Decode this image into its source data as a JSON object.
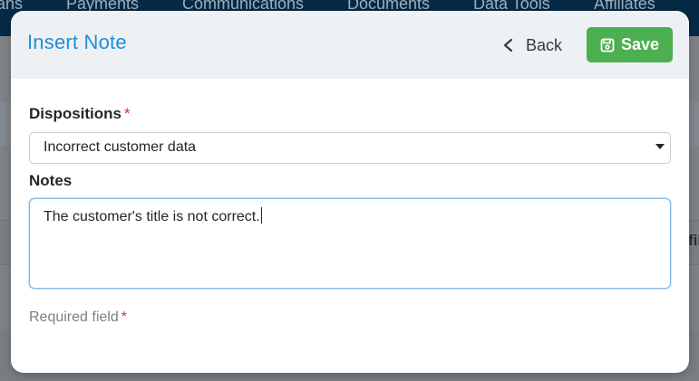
{
  "background": {
    "nav_items": [
      "ans",
      "Payments",
      "Communications",
      "Documents",
      "Data Tools",
      "Affiliates"
    ],
    "edge_text": "fil"
  },
  "modal": {
    "title": "Insert Note",
    "back_label": "Back",
    "save_label": "Save",
    "dispositions": {
      "label": "Dispositions",
      "required_star": "*",
      "selected": "Incorrect customer data"
    },
    "notes": {
      "label": "Notes",
      "value": "The customer's title is not correct."
    },
    "required_note": {
      "text": "Required field",
      "star": "*"
    }
  },
  "colors": {
    "title": "#1f8fd8",
    "save_bg": "#4caf50",
    "required": "#d32f2f",
    "nav_bg": "#062a46"
  },
  "icons": {
    "back": "chevron-left-icon",
    "save": "floppy-disk-icon",
    "select_caret": "caret-down-icon"
  }
}
